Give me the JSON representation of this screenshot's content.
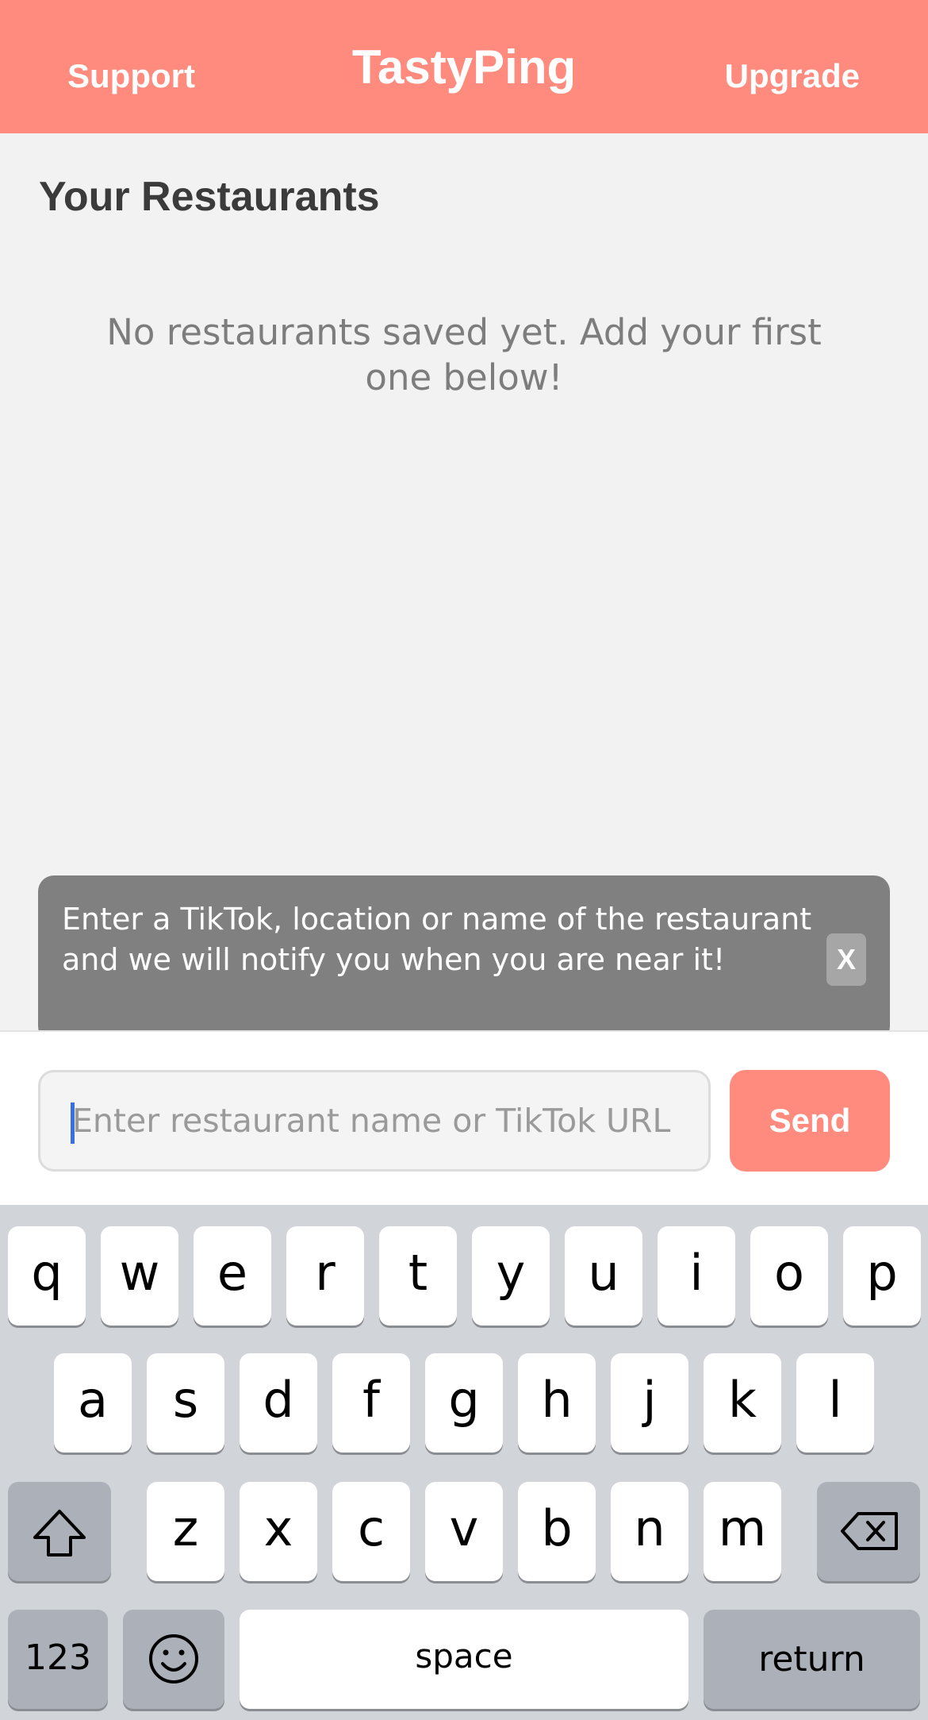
{
  "header": {
    "support_label": "Support",
    "title": "TastyPing",
    "upgrade_label": "Upgrade",
    "background": "#ff8a7e"
  },
  "content": {
    "section_title": "Your Restaurants",
    "empty_message": "No restaurants saved yet. Add your first one below!"
  },
  "tooltip": {
    "text": "Enter a TikTok, location or name of the restaurant and we will notify you when you are near it!",
    "close_label": "X"
  },
  "input_bar": {
    "placeholder": "Enter restaurant name or TikTok URL",
    "value": "",
    "send_label": "Send"
  },
  "keyboard": {
    "row1": [
      "q",
      "w",
      "e",
      "r",
      "t",
      "y",
      "u",
      "i",
      "o",
      "p"
    ],
    "row2": [
      "a",
      "s",
      "d",
      "f",
      "g",
      "h",
      "j",
      "k",
      "l"
    ],
    "row3": [
      "z",
      "x",
      "c",
      "v",
      "b",
      "n",
      "m"
    ],
    "shift_icon": "shift-arrow-icon",
    "delete_icon": "backspace-icon",
    "numbers_label": "123",
    "emoji_icon": "emoji-smiley-icon",
    "space_label": "space",
    "return_label": "return"
  }
}
